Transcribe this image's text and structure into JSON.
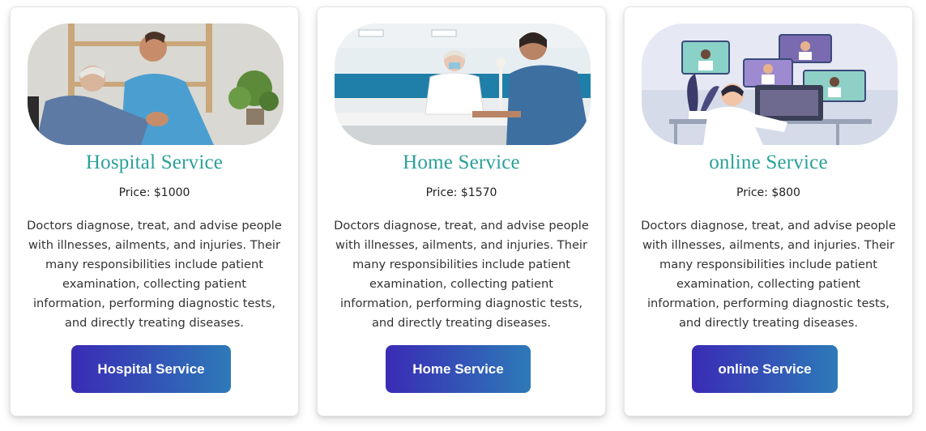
{
  "cards": [
    {
      "image_icon": "hospital-photo",
      "title": "Hospital Service",
      "price": "Price: $1000",
      "description": "Doctors diagnose, treat, and advise people with illnesses, ailments, and injuries. Their many responsibilities include patient examination, collecting patient information, performing diagnostic tests, and directly treating diseases.",
      "button_label": "Hospital Service"
    },
    {
      "image_icon": "home-service-photo",
      "title": "Home Service",
      "price": "Price: $1570",
      "description": "Doctors diagnose, treat, and advise people with illnesses, ailments, and injuries. Their many responsibilities include patient examination, collecting patient information, performing diagnostic tests, and directly treating diseases.",
      "button_label": "Home Service"
    },
    {
      "image_icon": "online-consultation-illustration",
      "title": "online Service",
      "price": "Price: $800",
      "description": "Doctors diagnose, treat, and advise people with illnesses, ailments, and injuries. Their many responsibilities include patient examination, collecting patient information, performing diagnostic tests, and directly treating diseases.",
      "button_label": "online Service"
    }
  ],
  "colors": {
    "title": "#2aa198",
    "button_gradient_start": "#3a2bb5",
    "button_gradient_end": "#2d7ab8"
  }
}
